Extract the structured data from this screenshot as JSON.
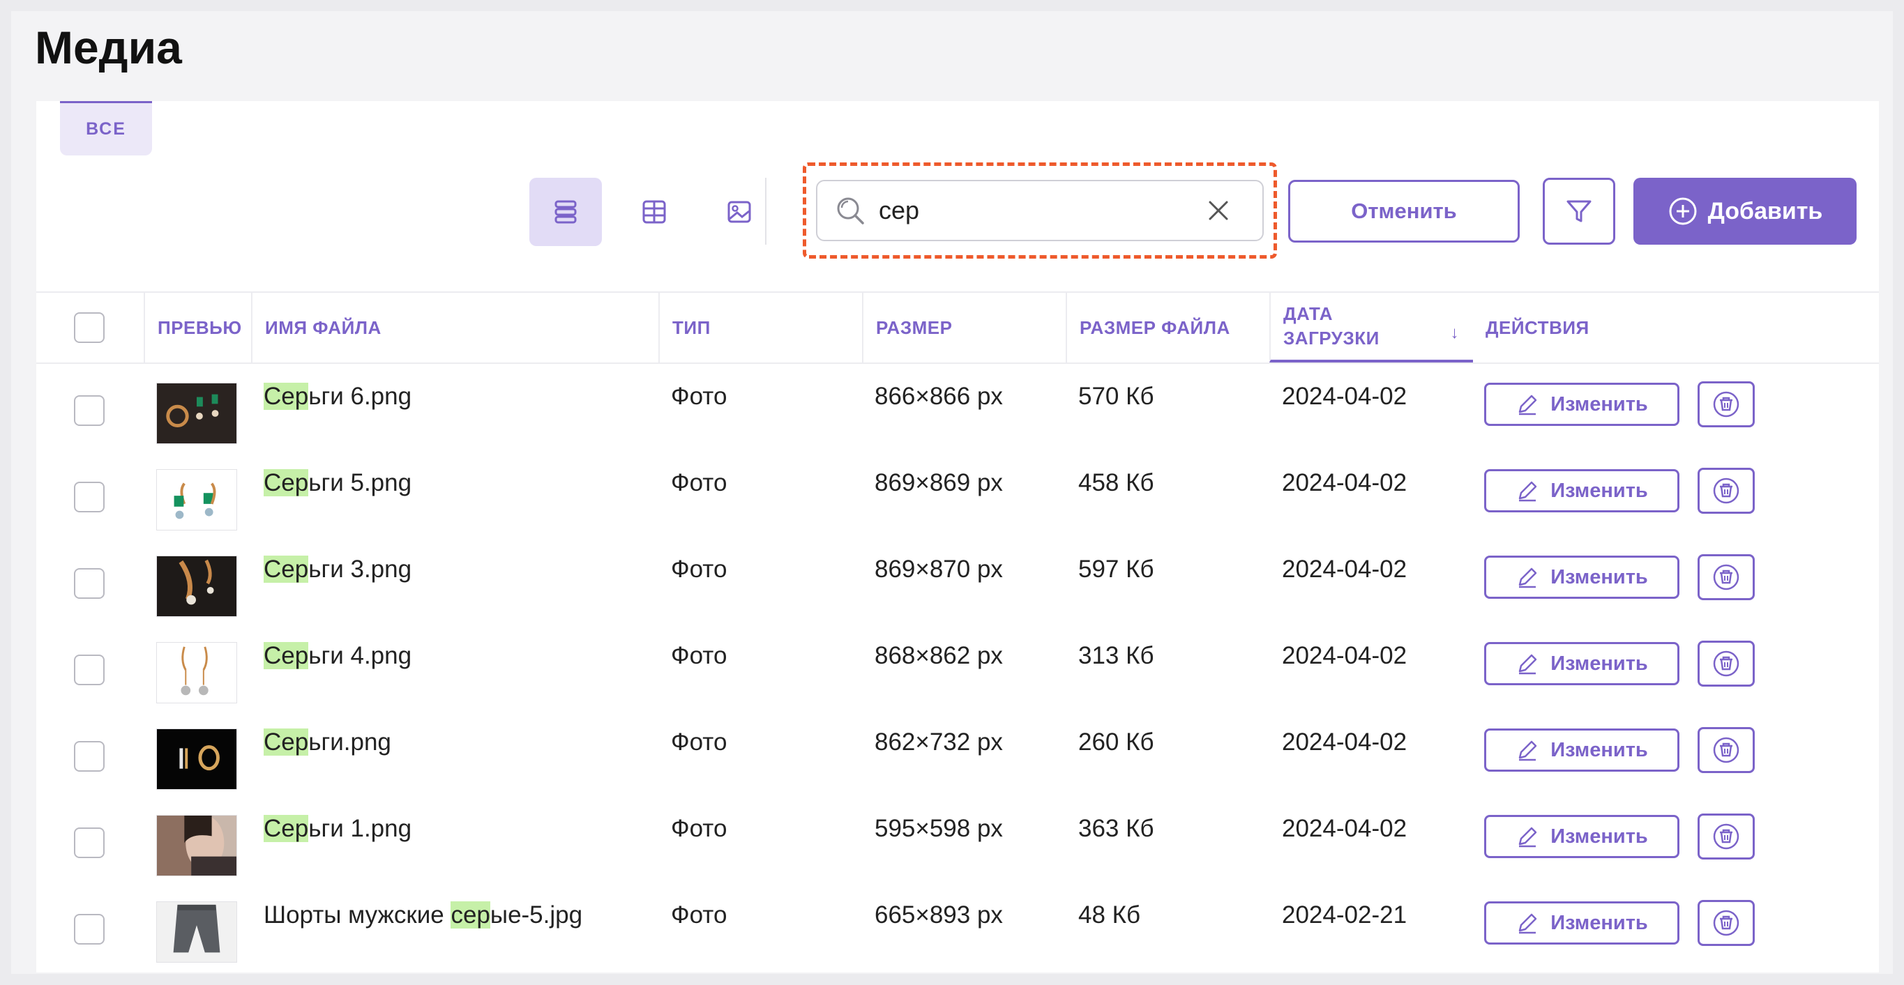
{
  "page": {
    "title": "Медиа"
  },
  "tabs": [
    {
      "label": "ВСЕ",
      "active": true
    }
  ],
  "toolbar": {
    "views": [
      {
        "icon": "list-view-icon",
        "active": true
      },
      {
        "icon": "grid-view-icon",
        "active": false
      },
      {
        "icon": "image-view-icon",
        "active": false
      }
    ],
    "search": {
      "value": "сер",
      "placeholder": ""
    },
    "cancel_label": "Отменить",
    "add_label": "Добавить"
  },
  "table": {
    "columns": {
      "preview": "ПРЕВЬЮ",
      "filename": "ИМЯ ФАЙЛА",
      "type": "ТИП",
      "dimensions": "РАЗМЕР",
      "filesize": "РАЗМЕР ФАЙЛА",
      "date_line1": "ДАТА",
      "date_line2": "ЗАГРУЗКИ",
      "actions": "ДЕЙСТВИЯ"
    },
    "sort_indicator": "↓",
    "edit_label": "Изменить",
    "rows": [
      {
        "name_pre": "",
        "name_hl": "Сер",
        "name_post": "ьги 6.png",
        "type": "Фото",
        "dims": "866×866 px",
        "size": "570 Кб",
        "date": "2024-04-02",
        "thumb": "dark-earrings"
      },
      {
        "name_pre": "",
        "name_hl": "Сер",
        "name_post": "ьги 5.png",
        "type": "Фото",
        "dims": "869×869 px",
        "size": "458 Кб",
        "date": "2024-04-02",
        "thumb": "gold-green-earrings"
      },
      {
        "name_pre": "",
        "name_hl": "Сер",
        "name_post": "ьги 3.png",
        "type": "Фото",
        "dims": "869×870 px",
        "size": "597 Кб",
        "date": "2024-04-02",
        "thumb": "dark-gold-earrings"
      },
      {
        "name_pre": "",
        "name_hl": "Сер",
        "name_post": "ьги 4.png",
        "type": "Фото",
        "dims": "868×862 px",
        "size": "313 Кб",
        "date": "2024-04-02",
        "thumb": "white-gold-earrings"
      },
      {
        "name_pre": "",
        "name_hl": "Сер",
        "name_post": "ьги.png",
        "type": "Фото",
        "dims": "862×732 px",
        "size": "260 Кб",
        "date": "2024-04-02",
        "thumb": "black-hoop-earrings"
      },
      {
        "name_pre": "",
        "name_hl": "Сер",
        "name_post": "ьги 1.png",
        "type": "Фото",
        "dims": "595×598 px",
        "size": "363 Кб",
        "date": "2024-04-02",
        "thumb": "model-portrait"
      },
      {
        "name_pre": "Шорты мужские ",
        "name_hl": "сер",
        "name_post": "ые-5.jpg",
        "type": "Фото",
        "dims": "665×893 px",
        "size": "48 Кб",
        "date": "2024-02-21",
        "thumb": "grey-shorts"
      }
    ]
  },
  "colors": {
    "accent": "#7b63c9",
    "highlight": "#c6f0a8",
    "search_outline": "#ee5a2c"
  }
}
